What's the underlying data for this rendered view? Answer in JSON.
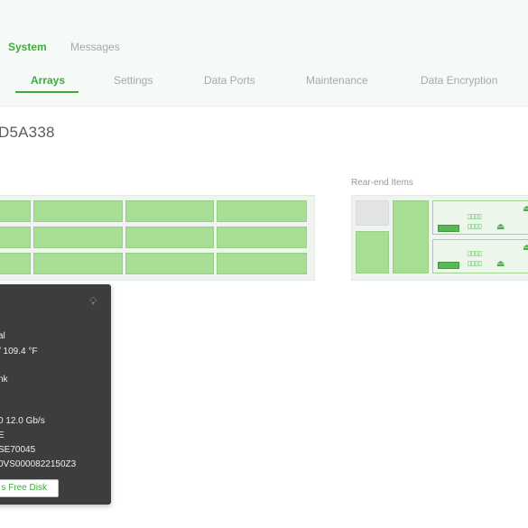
{
  "tabs": {
    "system": "System",
    "messages": "Messages"
  },
  "sub_tabs": [
    "Arrays",
    "Settings",
    "Data Ports",
    "Maintenance",
    "Data Encryption"
  ],
  "device_title": "D5A338",
  "rear_label": "Rear-end Items",
  "tooltip": {
    "lines": [
      "al",
      "/ 109.4 °F",
      "nk",
      "l",
      "0 12.0 Gb/s",
      "E",
      "SE70045",
      "0VS0000822150Z3"
    ],
    "button": "s Free Disk"
  },
  "icons": {
    "lightbulb": "lightbulb-icon",
    "port": "port-icon"
  },
  "colors": {
    "accent": "#3eaa3e",
    "disk_fill": "#a7dd95",
    "tooltip_bg": "#3d3d3d"
  }
}
